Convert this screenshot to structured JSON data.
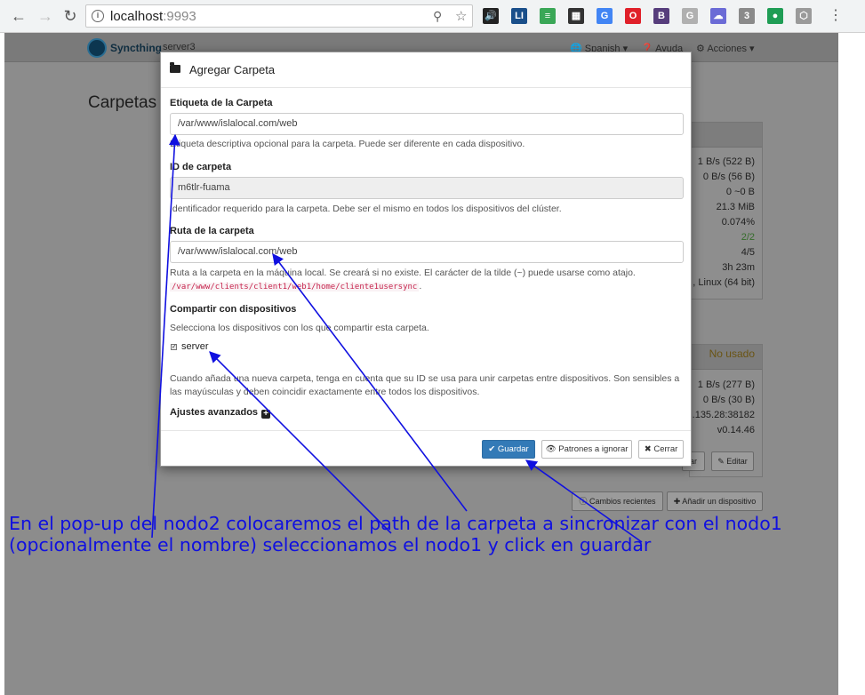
{
  "browser": {
    "url_host": "localhost",
    "url_port": ":9993",
    "extensions": [
      {
        "icon": "speaker-icon",
        "text": "🔊",
        "color": "#222222"
      },
      {
        "icon": "li-extension-icon",
        "text": "LI",
        "color": "#1a4f8a"
      },
      {
        "icon": "color-bars-extension-icon",
        "text": "≡",
        "color": "#3aa757"
      },
      {
        "icon": "film-extension-icon",
        "text": "▦",
        "color": "#333333"
      },
      {
        "icon": "translate-extension-icon",
        "text": "G",
        "color": "#4285f4"
      },
      {
        "icon": "opera-extension-icon",
        "text": "O",
        "color": "#e0202a"
      },
      {
        "icon": "bootstrap-extension-icon",
        "text": "B",
        "color": "#563d7c"
      },
      {
        "icon": "g-gray-extension-icon",
        "text": "G",
        "color": "#b0b0b0"
      },
      {
        "icon": "cloud-extension-icon",
        "text": "☁",
        "color": "#6b6bd6"
      },
      {
        "icon": "network-extension-icon",
        "text": "3",
        "color": "#8a8a8a"
      },
      {
        "icon": "green-leaf-extension-icon",
        "text": "●",
        "color": "#1f9d55"
      },
      {
        "icon": "cube-extension-icon",
        "text": "⬡",
        "color": "#9a9a9a"
      }
    ],
    "menu_glyph": "⋮"
  },
  "app": {
    "brand": "Syncthing",
    "device": "server3",
    "nav": {
      "language": "Spanish",
      "help": "Ayuda",
      "actions": "Acciones"
    },
    "heading": "Carpetas",
    "panel_top_stats": [
      "1 B/s (522 B)",
      "0 B/s (56 B)",
      "0  ~0 B",
      "21.3 MiB",
      "0.074%",
      "2/2",
      "4/5",
      "3h 23m",
      ", Linux (64 bit)"
    ],
    "panel_bottom_status": "No usado",
    "panel_bottom_stats": [
      "1 B/s (277 B)",
      "0 B/s (30 B)",
      ".135.28:38182",
      "v0.14.46"
    ],
    "btn_edit_left": "ar",
    "btn_edit": "Editar",
    "btn_recent": "Cambios recientes",
    "btn_add_device": "Añadir un dispositivo"
  },
  "modal": {
    "title": "Agregar Carpeta",
    "label_field": {
      "label": "Etiqueta de la Carpeta",
      "value": "/var/www/islalocal.com/web",
      "help": "Etiqueta descriptiva opcional para la carpeta. Puede ser diferente en cada dispositivo."
    },
    "id_field": {
      "label": "ID de carpeta",
      "value": "m6tlr-fuama",
      "help": "Identificador requerido para la carpeta. Debe ser el mismo en todos los dispositivos del clúster."
    },
    "path_field": {
      "label": "Ruta de la carpeta",
      "value": "/var/www/islalocal.com/web",
      "help": "Ruta a la carpeta en la máquina local. Se creará si no existe. El carácter de la tilde (~) puede usarse como atajo.",
      "code": "/var/www/clients/client1/web1/home/cliente1usersync",
      "code_suffix": "."
    },
    "share": {
      "label": "Compartir con dispositivos",
      "help": "Selecciona los dispositivos con los que compartir esta carpeta.",
      "device": "server",
      "checked": true
    },
    "note": "Cuando añada una nueva carpeta, tenga en cuenta que su ID se usa para unir carpetas entre dispositivos. Son sensibles a las mayúsculas y deben coincidir exactamente entre todos los dispositivos.",
    "advanced": "Ajustes avanzados",
    "buttons": {
      "save": "Guardar",
      "ignore": "Patrones a ignorar",
      "close": "Cerrar"
    }
  },
  "annotation": {
    "text": "En el pop-up del nodo2 colocaremos el path de la carpeta a sincronizar con el nodo1 (opcionalmente el nombre) seleccionamos el nodo1 y click en guardar",
    "color": "#1010e0"
  }
}
